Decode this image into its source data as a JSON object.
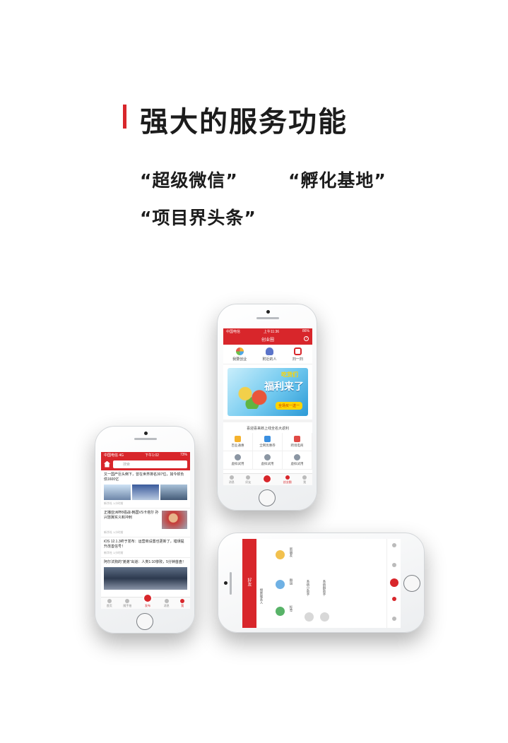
{
  "header": {
    "title": "强大的服务功能",
    "features": [
      "“超级微信”",
      "“孵化基地”",
      "“项目界头条”"
    ]
  },
  "colors": {
    "accent": "#d8262b",
    "text": "#1c1c1c"
  },
  "phone_right": {
    "status": {
      "carrier": "中国电信",
      "time": "上午11:36",
      "battery": "86%"
    },
    "nav_title": "创业圈",
    "quick": [
      {
        "label": "我要创业",
        "icon": "flower-icon"
      },
      {
        "label": "附近的人",
        "icon": "people-icon"
      },
      {
        "label": "扫一扫",
        "icon": "scan-icon"
      }
    ],
    "banner": {
      "small": "吃货们",
      "big": "福利来了",
      "button": "全场买一送一"
    },
    "section_title": "喜迎喜来郎上线全名大返利",
    "grid": [
      "百业通惠",
      "全网优惠券",
      "跨境电商",
      "虚拟试用",
      "虚拟试用",
      "虚拟试用"
    ],
    "tabs": [
      "消息",
      "好友",
      "",
      "创业圈",
      "我"
    ]
  },
  "phone_left": {
    "status": {
      "carrier": "中国电信 4G",
      "time": "下午1:02",
      "battery": "73%"
    },
    "search_placeholder": "搜索",
    "news": [
      {
        "title": "又一国产巨头倒下，曾在世界排名307位，如今却负债1600亿",
        "meta": "新华社  1小时前"
      },
      {
        "title": "正播亚洲杯8强战-韩国VS卡塔尔 孙兴慜冀实义和冲刺",
        "meta": "新华社  1小时前"
      },
      {
        "title": "iOS 12.1.3终于发布：运营商设置也更新了，错误提升改善信号！",
        "meta": "新华社  1小时前"
      },
      {
        "title": "阿尔法狗的“弟弟”出道：人类1:10惨败，5分钟首盘！",
        "meta": ""
      }
    ],
    "tabs": [
      "首页",
      "随手拍",
      "发布",
      "消息",
      "我"
    ]
  },
  "phone_landscape": {
    "title": "好友",
    "search": "搜索联系人",
    "items": [
      "新朋友",
      "群组",
      "标签"
    ],
    "contacts": [
      "系统小助手",
      "系统群助手"
    ]
  }
}
